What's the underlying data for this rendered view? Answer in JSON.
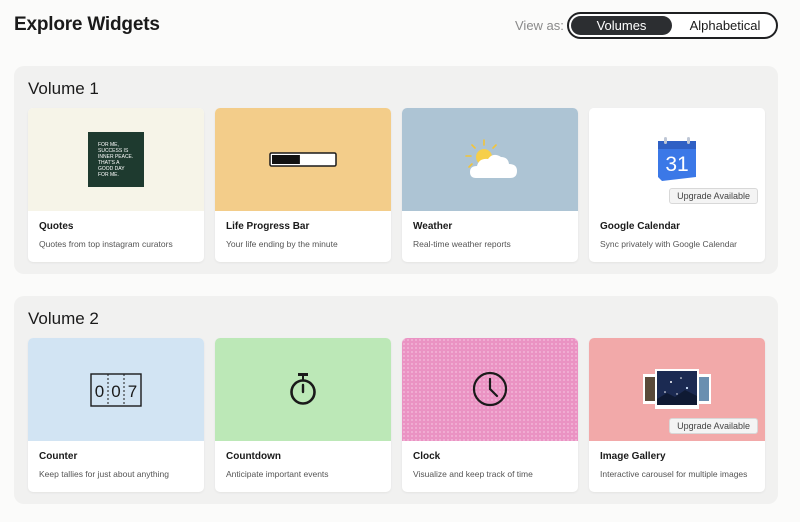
{
  "header": {
    "title": "Explore Widgets",
    "view_as_label": "View as:",
    "view_options": [
      "Volumes",
      "Alphabetical"
    ],
    "selected_view": "Volumes"
  },
  "volumes": [
    {
      "title": "Volume 1",
      "widgets": [
        {
          "name": "Quotes",
          "description": "Quotes from top instagram curators",
          "thumb_color": "#f6f4e8",
          "quote_text": [
            "FOR ME,",
            "SUCCESS IS",
            "INNER PEACE.",
            "THAT'S A",
            "GOOD DAY",
            "FOR ME."
          ]
        },
        {
          "name": "Life Progress Bar",
          "description": "Your life ending by the minute",
          "thumb_color": "#f3cd8a",
          "progress": 0.45
        },
        {
          "name": "Weather",
          "description": "Real-time weather reports",
          "thumb_color": "#adc4d4"
        },
        {
          "name": "Google Calendar",
          "description": "Sync privately with Google Calendar",
          "thumb_color": "#ffffff",
          "calendar_day": "31",
          "badge": "Upgrade Available"
        }
      ]
    },
    {
      "title": "Volume 2",
      "widgets": [
        {
          "name": "Counter",
          "description": "Keep tallies for just about anything",
          "thumb_color": "#d2e4f3",
          "digits": [
            "0",
            "0",
            "7"
          ]
        },
        {
          "name": "Countdown",
          "description": "Anticipate important events",
          "thumb_color": "#bce8b7"
        },
        {
          "name": "Clock",
          "description": "Visualize and keep track of time",
          "thumb_color": "#ea93c3"
        },
        {
          "name": "Image Gallery",
          "description": "Interactive carousel for multiple images",
          "thumb_color": "#f2a9a9",
          "badge": "Upgrade Available"
        }
      ]
    }
  ]
}
